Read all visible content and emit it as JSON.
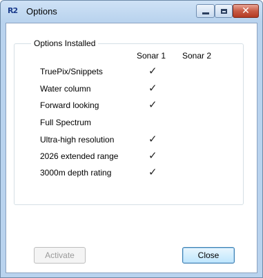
{
  "window": {
    "app_icon_text": "R2",
    "title": "Options"
  },
  "options_group": {
    "title": "Options Installed",
    "columns": [
      "Sonar 1",
      "Sonar 2"
    ],
    "rows": [
      {
        "label": "TruePix/Snippets",
        "sonar1": "✓",
        "sonar2": ""
      },
      {
        "label": "Water column",
        "sonar1": "✓",
        "sonar2": ""
      },
      {
        "label": "Forward looking",
        "sonar1": "✓",
        "sonar2": ""
      },
      {
        "label": "Full Spectrum",
        "sonar1": "",
        "sonar2": ""
      },
      {
        "label": "Ultra-high resolution",
        "sonar1": "✓",
        "sonar2": ""
      },
      {
        "label": "2026 extended range",
        "sonar1": "✓",
        "sonar2": ""
      },
      {
        "label": "3000m depth rating",
        "sonar1": "✓",
        "sonar2": ""
      }
    ]
  },
  "buttons": {
    "activate": "Activate",
    "close": "Close"
  }
}
